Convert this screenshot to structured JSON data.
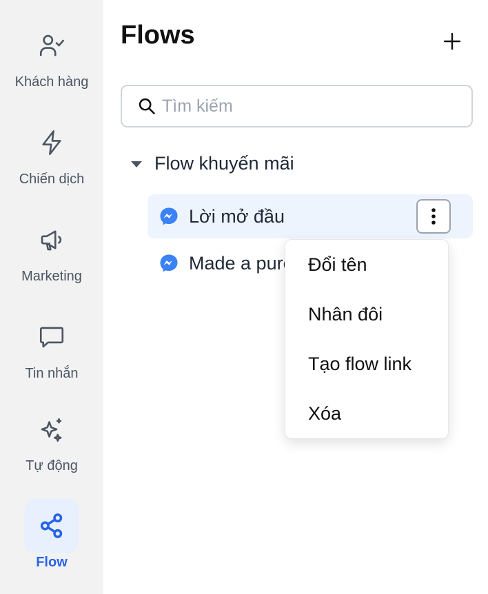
{
  "sidebar": {
    "items": [
      {
        "label": "Khách hàng",
        "icon": "user-check-icon"
      },
      {
        "label": "Chiến dịch",
        "icon": "lightning-icon"
      },
      {
        "label": "Marketing",
        "icon": "megaphone-icon"
      },
      {
        "label": "Tin nhắn",
        "icon": "message-icon"
      },
      {
        "label": "Tự động",
        "icon": "sparkles-icon"
      },
      {
        "label": "Flow",
        "icon": "share-icon",
        "active": true
      }
    ]
  },
  "main": {
    "title": "Flows",
    "add_icon": "plus-icon",
    "search": {
      "placeholder": "Tìm kiếm",
      "value": ""
    },
    "folder": {
      "label": "Flow khuyến mãi",
      "expanded": true
    },
    "flows": [
      {
        "label": "Lời mở đầu",
        "channel": "messenger",
        "selected": true
      },
      {
        "label": "Made a purchase",
        "channel": "messenger",
        "selected": false
      }
    ]
  },
  "context_menu": {
    "items": [
      "Đổi tên",
      "Nhân đôi",
      "Tạo flow link",
      "Xóa"
    ]
  },
  "colors": {
    "accent": "#2563eb",
    "sidebar_bg": "#f2f2f2",
    "selected_bg": "#eef4fd",
    "messenger": "#3b82f6"
  }
}
